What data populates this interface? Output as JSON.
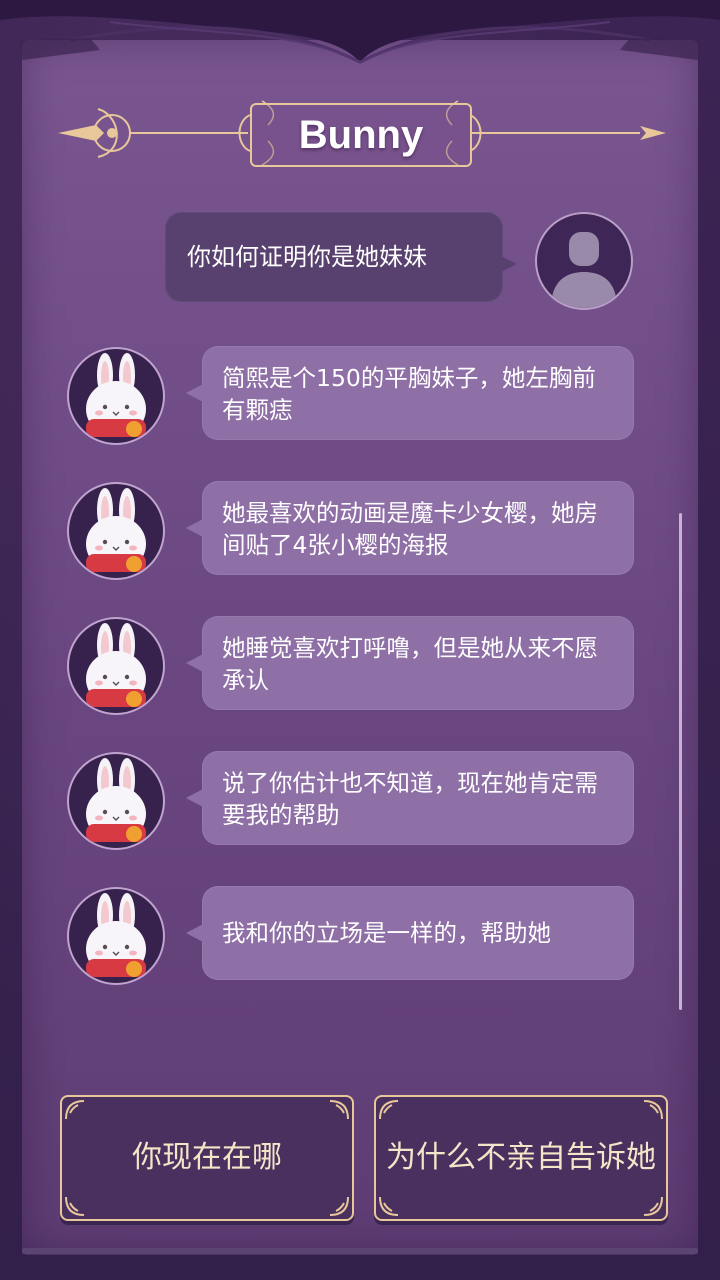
{
  "header": {
    "title": "Bunny"
  },
  "messages": [
    {
      "from": "player",
      "text": "你如何证明你是她妹妹"
    },
    {
      "from": "bunny",
      "text": "简熙是个150的平胸妹子，她左胸前有颗痣"
    },
    {
      "from": "bunny",
      "text": "她最喜欢的动画是魔卡少女樱，她房间贴了4张小樱的海报"
    },
    {
      "from": "bunny",
      "text": "她睡觉喜欢打呼噜，但是她从来不愿承认"
    },
    {
      "from": "bunny",
      "text": "说了你估计也不知道，现在她肯定需要我的帮助"
    },
    {
      "from": "bunny",
      "text": "我和你的立场是一样的，帮助她"
    }
  ],
  "choices": [
    {
      "label": "你现在在哪"
    },
    {
      "label": "为什么不亲自告诉她"
    }
  ],
  "colors": {
    "accent_gold": "#e8c79a",
    "panel": "#6a4680",
    "bubble": "#8e6fa6",
    "player_bubble": "#58416f"
  },
  "icons": {
    "left_ornament": "compass-arrow-icon",
    "player_avatar": "user-silhouette-icon",
    "bunny_avatar": "bunny-avatar"
  }
}
